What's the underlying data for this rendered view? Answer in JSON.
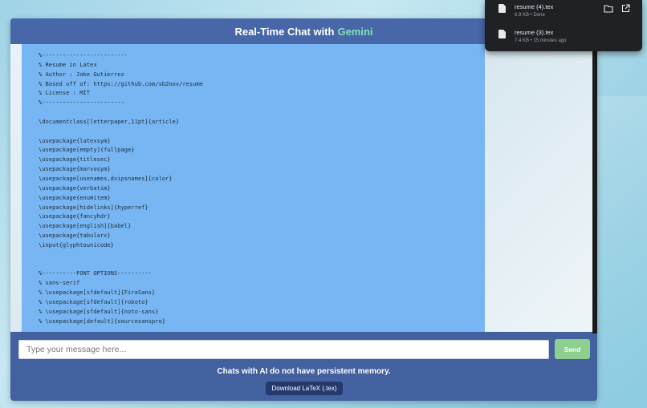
{
  "header": {
    "title_prefix": "Real-Time Chat with",
    "title_accent": "Gemini"
  },
  "message": {
    "lines": [
      "%-------------------------",
      "% Resume in Latex",
      "% Author : Jake Gutierrez",
      "% Based off of: https://github.com/sb2nov/resume",
      "% License : MIT",
      "%------------------------",
      "",
      "\\documentclass[letterpaper,11pt]{article}",
      "",
      "\\usepackage{latexsym}",
      "\\usepackage[empty]{fullpage}",
      "\\usepackage{titlesec}",
      "\\usepackage{marvosym}",
      "\\usepackage[usenames,dvipsnames]{color}",
      "\\usepackage{verbatim}",
      "\\usepackage{enumitem}",
      "\\usepackage[hidelinks]{hyperref}",
      "\\usepackage{fancyhdr}",
      "\\usepackage[english]{babel}",
      "\\usepackage{tabularx}",
      "\\input{glyphtounicode}",
      "",
      "",
      "%----------FONT OPTIONS----------",
      "% sans-serif",
      "% \\usepackage[sfdefault]{FiraSans}",
      "% \\usepackage[sfdefault]{roboto}",
      "% \\usepackage[sfdefault]{noto-sans}",
      "% \\usepackage[default]{sourcesanspro}"
    ]
  },
  "composer": {
    "placeholder": "Type your message here...",
    "send_label": "Send",
    "memory_note": "Chats with AI do not have persistent memory.",
    "download_label": "Download LaTeX (.tex)"
  },
  "downloads": {
    "items": [
      {
        "name": "resume (4).tex",
        "meta": "6.9 KB • Done"
      },
      {
        "name": "resume (3).tex",
        "meta": "7.4 KB • 15 minutes ago"
      }
    ],
    "icons": [
      "file-icon",
      "folder-icon",
      "open-external-icon"
    ]
  },
  "colors": {
    "header_bg": "#4867a8",
    "accent": "#7fe3b8",
    "bubble": "#77b6f2",
    "send": "#8ccf8f",
    "download_button": "#24396e"
  }
}
